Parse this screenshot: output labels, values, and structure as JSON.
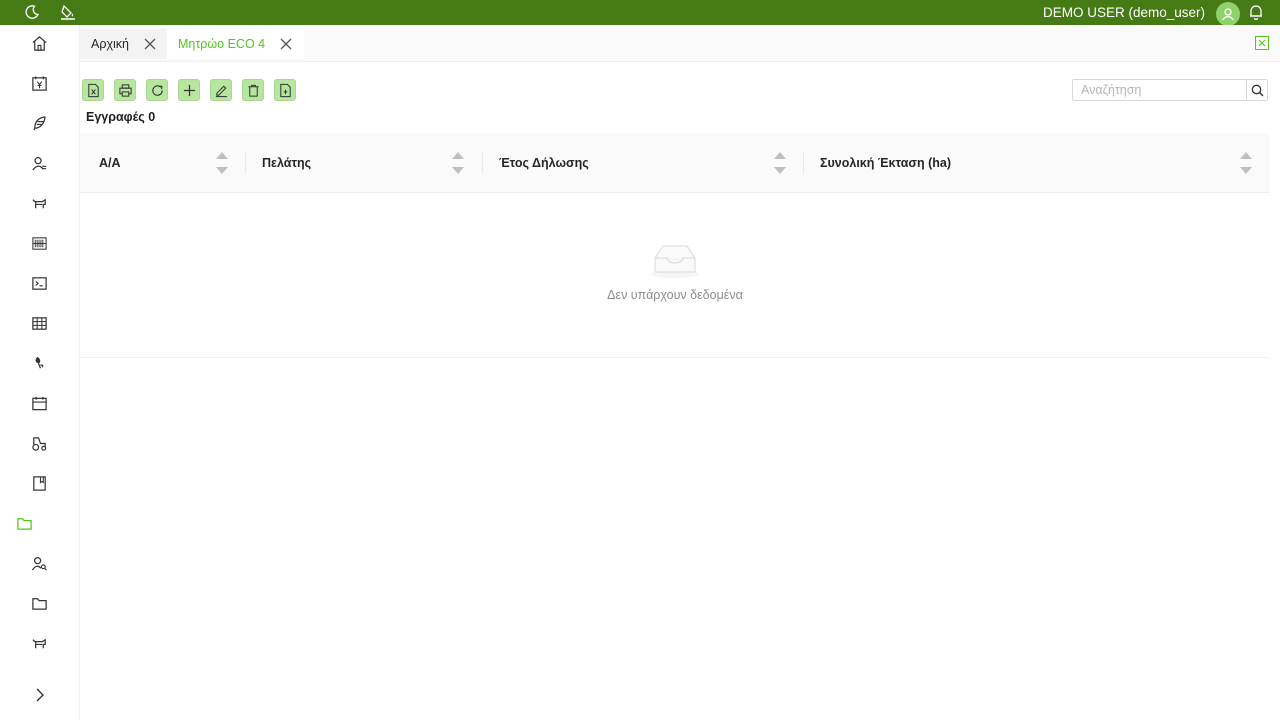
{
  "topbar": {
    "user": "DEMO USER (demo_user)",
    "bg_color": "#467a15"
  },
  "sidebar": {
    "items": [
      {
        "icon": "home-icon"
      },
      {
        "icon": "invoice-icon"
      },
      {
        "icon": "feather-icon"
      },
      {
        "icon": "user-list-icon"
      },
      {
        "icon": "livestock-icon"
      },
      {
        "icon": "barcode-icon"
      },
      {
        "icon": "terminal-icon"
      },
      {
        "icon": "table-icon"
      },
      {
        "icon": "seed-icon"
      },
      {
        "icon": "calendar-icon"
      },
      {
        "icon": "tractor-icon"
      },
      {
        "icon": "book-icon"
      },
      {
        "icon": "folder-icon",
        "active": true
      },
      {
        "icon": "user-search-icon"
      },
      {
        "icon": "folder-icon"
      },
      {
        "icon": "livestock-icon"
      }
    ]
  },
  "tabs": [
    {
      "label": "Αρχική",
      "active": false
    },
    {
      "label": "Μητρώο ECO 4",
      "active": true
    }
  ],
  "toolbar": {
    "buttons": [
      "excel-export",
      "print",
      "refresh",
      "add",
      "edit",
      "delete",
      "file-export"
    ]
  },
  "search": {
    "placeholder": "Αναζήτηση"
  },
  "records_label": "Εγγραφές 0",
  "table": {
    "columns": [
      "Α/Α",
      "Πελάτης",
      "Έτος Δήλωσης",
      "Συνολική Έκταση (ha)"
    ],
    "rows": [],
    "empty_text": "Δεν υπάρχουν δεδομένα"
  },
  "colors": {
    "accent": "#52c41a",
    "button_bg": "#b7e6a0"
  }
}
